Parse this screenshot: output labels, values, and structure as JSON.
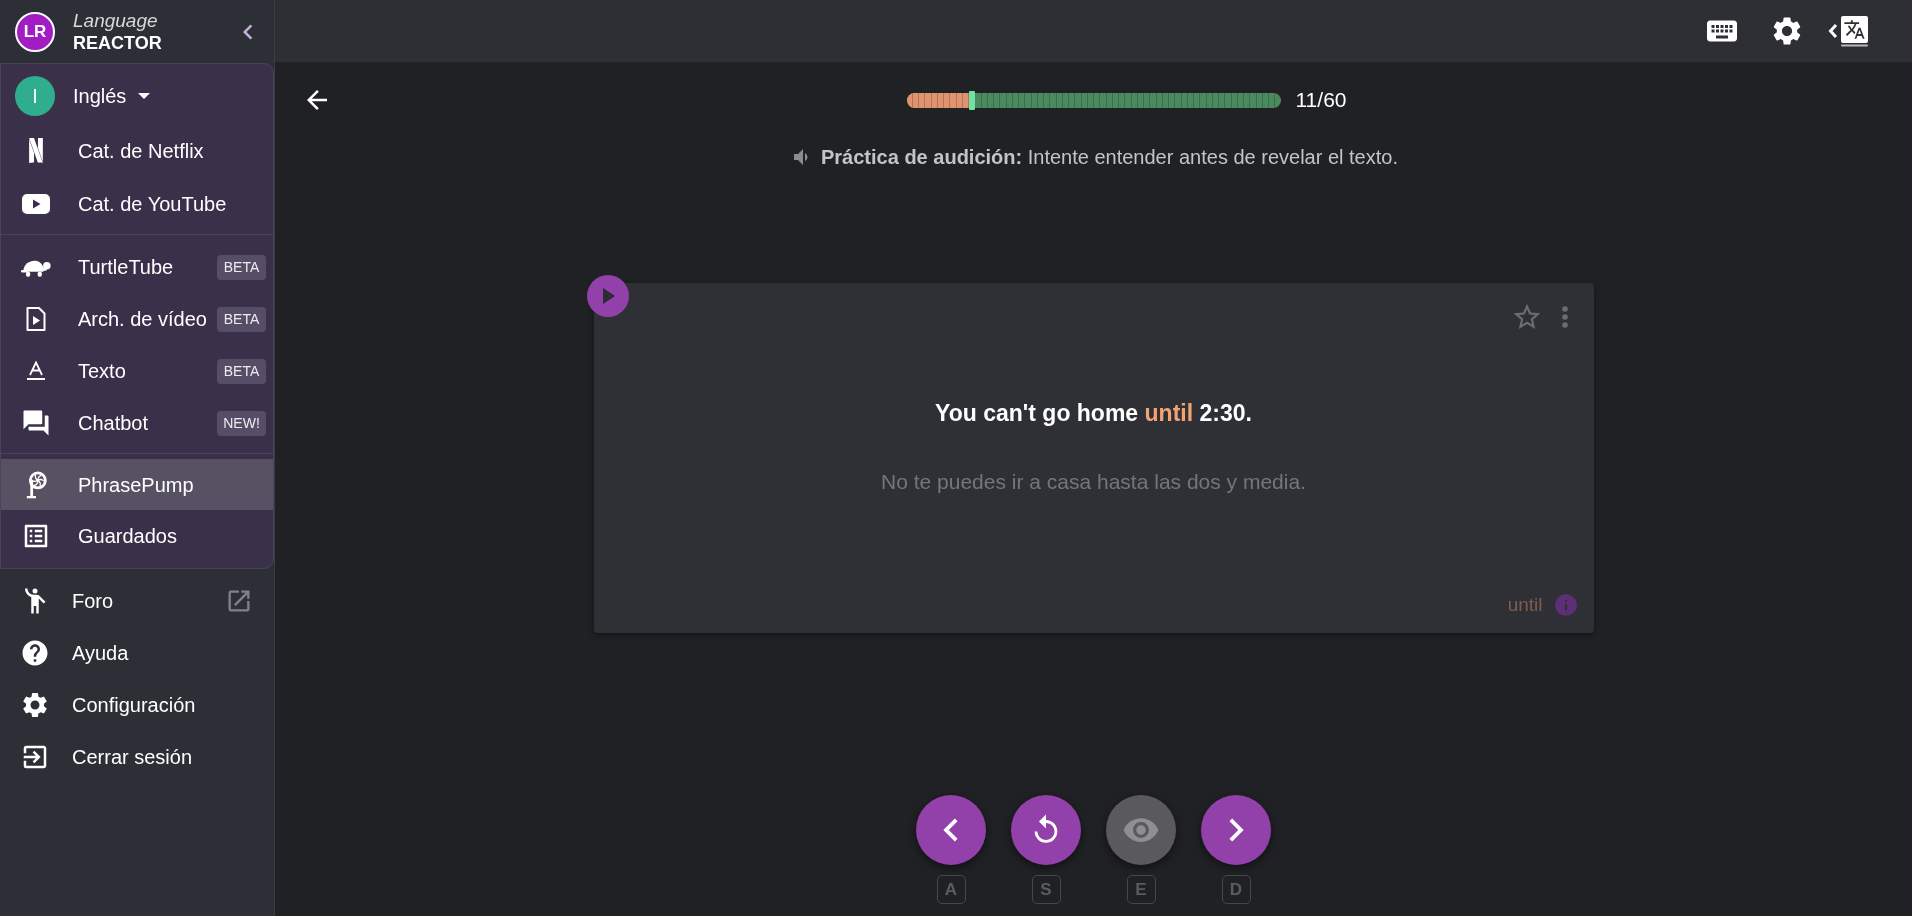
{
  "sidebar": {
    "logo": {
      "mark": "LR",
      "line_1": "Language",
      "line_2": "REACTOR"
    },
    "language": {
      "initial": "I",
      "label": "Inglés"
    },
    "menu_sections": [
      {
        "items": [
          {
            "kind": "netflix",
            "label": "Cat. de Netflix",
            "selected": false
          },
          {
            "kind": "youtube",
            "label": "Cat. de YouTube",
            "selected": false
          }
        ]
      },
      {
        "items": [
          {
            "kind": "turtle",
            "label": "TurtleTube",
            "badge": "BETA",
            "selected": false
          },
          {
            "kind": "video_file",
            "label": "Arch. de vídeo",
            "badge": "BETA",
            "selected": false
          },
          {
            "kind": "text",
            "label": "Texto",
            "badge": "BETA",
            "selected": false
          },
          {
            "kind": "chat",
            "label": "Chatbot",
            "badge": "NEW!",
            "selected": false
          }
        ]
      },
      {
        "items": [
          {
            "kind": "pump",
            "label": "PhrasePump",
            "selected": true
          },
          {
            "kind": "list",
            "label": "Guardados",
            "selected": false
          }
        ]
      }
    ],
    "links": [
      {
        "kind": "forum",
        "label": "Foro",
        "external": true
      },
      {
        "kind": "help",
        "label": "Ayuda",
        "external": false
      },
      {
        "kind": "settings",
        "label": "Configuración",
        "external": false
      },
      {
        "kind": "logout",
        "label": "Cerrar sesión",
        "external": false
      }
    ]
  },
  "progress": {
    "level": 0.1833,
    "reading": "11/60"
  },
  "hint": "**Práctica de audición:** Intente entender antes de revelar el texto.",
  "card": {
    "starred": false,
    "sentence_parts": [
      {
        "text": "You can't go home ",
        "highlight": false
      },
      {
        "text": "until",
        "highlight": true
      },
      {
        "text": " 2:30.",
        "highlight": false
      }
    ],
    "translation": "No te puedes ir a casa hasta las dos y media.",
    "keyword": "until"
  },
  "controls": [
    {
      "kind": "previous",
      "key": "A",
      "disabled": false
    },
    {
      "kind": "replay",
      "key": "S",
      "disabled": false
    },
    {
      "kind": "reveal",
      "key": "E",
      "disabled": true
    },
    {
      "kind": "next",
      "key": "D",
      "disabled": false
    }
  ]
}
